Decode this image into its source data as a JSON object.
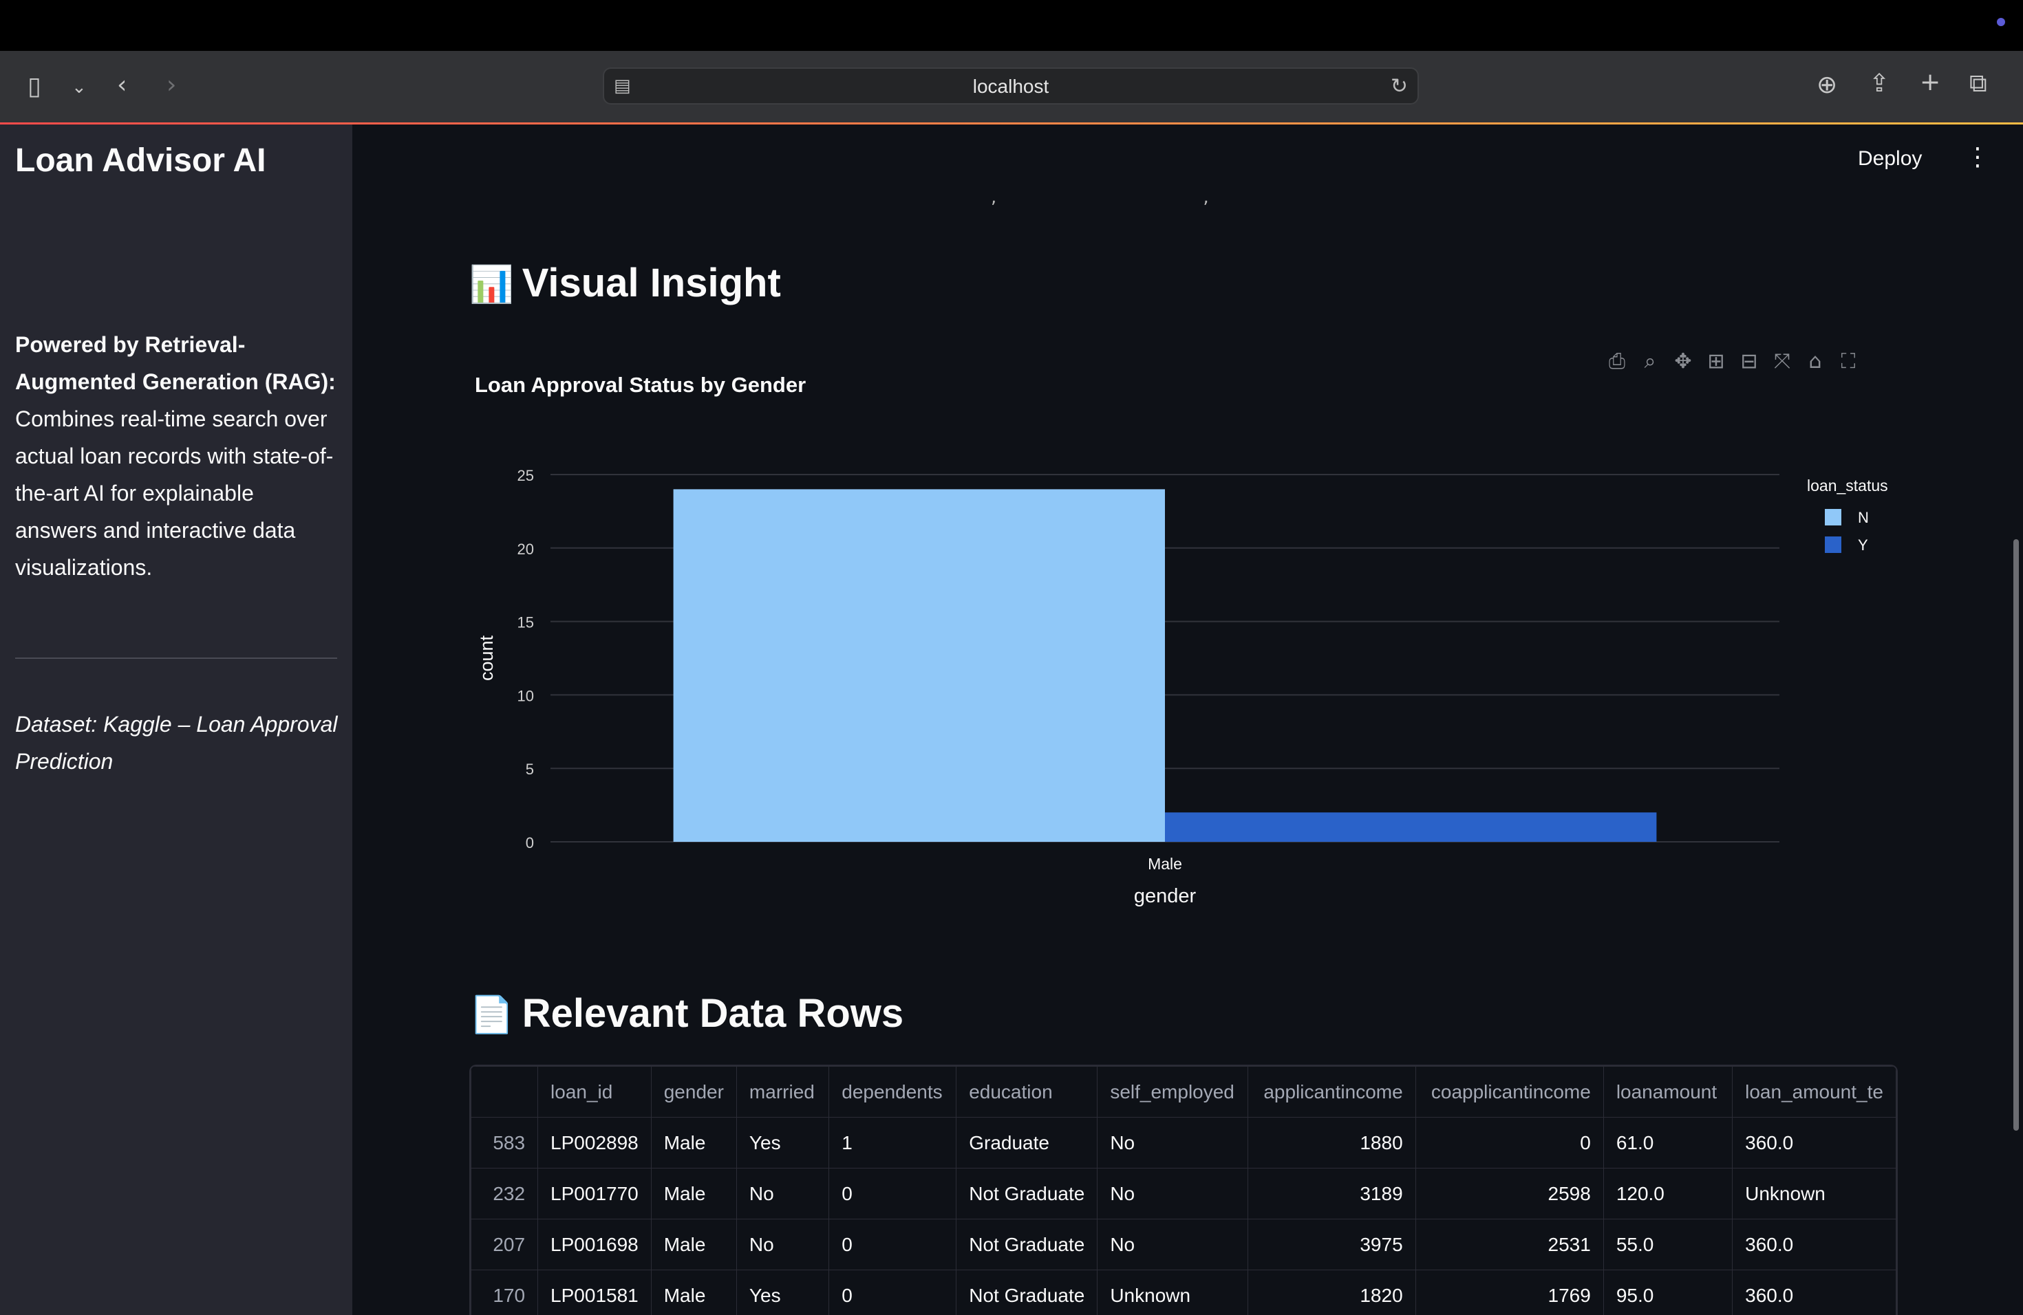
{
  "browser": {
    "url": "localhost"
  },
  "app": {
    "deploy_label": "Deploy"
  },
  "sidebar": {
    "title": "Loan Advisor AI",
    "description_bold": "Powered by Retrieval-Augmented Generation (RAG):",
    "description_rest": "Combines real-time search over actual loan records with state-of-the-art AI for explainable answers and interactive data visualizations.",
    "dataset": "Dataset: Kaggle – Loan Approval Prediction"
  },
  "sections": {
    "visual_emoji": "📊",
    "visual_title": "Visual Insight",
    "rows_emoji": "📄",
    "rows_title": "Relevant Data Rows"
  },
  "chart_data": {
    "type": "bar",
    "title": "Loan Approval Status by Gender",
    "xlabel": "gender",
    "ylabel": "count",
    "categories": [
      "Male"
    ],
    "ylim": [
      0,
      25
    ],
    "yticks": [
      0,
      5,
      10,
      15,
      20,
      25
    ],
    "grid": true,
    "legend_title": "loan_status",
    "legend_position": "top-right",
    "barmode": "group",
    "series": [
      {
        "name": "N",
        "values": [
          24
        ],
        "color": "#90c8f8"
      },
      {
        "name": "Y",
        "values": [
          2
        ],
        "color": "#2a62c9"
      }
    ]
  },
  "table": {
    "columns": [
      "",
      "loan_id",
      "gender",
      "married",
      "dependents",
      "education",
      "self_employed",
      "applicantincome",
      "coapplicantincome",
      "loanamount",
      "loan_amount_te"
    ],
    "rows": [
      [
        "583",
        "LP002898",
        "Male",
        "Yes",
        "1",
        "Graduate",
        "No",
        "1880",
        "0",
        "61.0",
        "360.0"
      ],
      [
        "232",
        "LP001770",
        "Male",
        "No",
        "0",
        "Not Graduate",
        "No",
        "3189",
        "2598",
        "120.0",
        "Unknown"
      ],
      [
        "207",
        "LP001698",
        "Male",
        "No",
        "0",
        "Not Graduate",
        "No",
        "3975",
        "2531",
        "55.0",
        "360.0"
      ],
      [
        "170",
        "LP001581",
        "Male",
        "Yes",
        "0",
        "Not Graduate",
        "Unknown",
        "1820",
        "1769",
        "95.0",
        "360.0"
      ]
    ]
  }
}
